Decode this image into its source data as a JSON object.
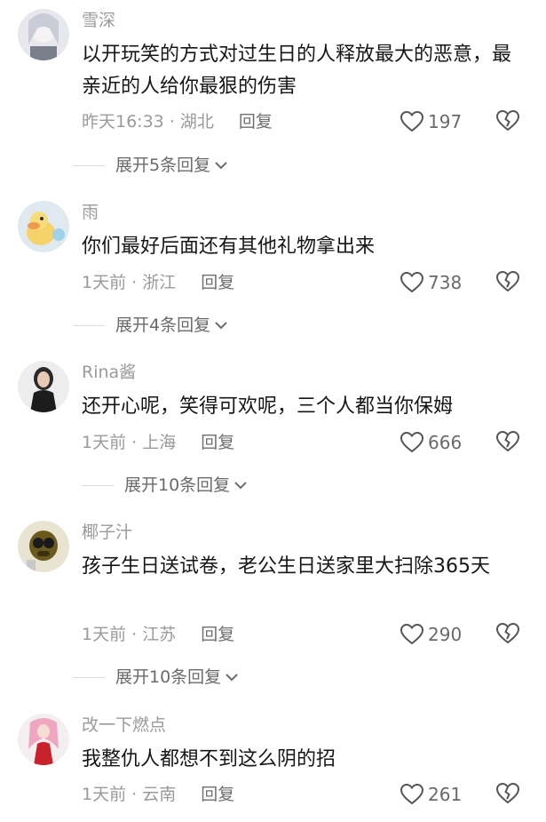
{
  "comments": [
    {
      "user": "雪深",
      "text": "以开玩笑的方式对过生日的人释放最大的恶意，最亲近的人给你最狠的伤害",
      "meta": "昨天16:33 · 湖北",
      "reply": "回复",
      "likes": "197",
      "expand": "展开5条回复"
    },
    {
      "user": "雨",
      "text": "你们最好后面还有其他礼物拿出来",
      "meta": "1天前 · 浙江",
      "reply": "回复",
      "likes": "738",
      "expand": "展开4条回复"
    },
    {
      "user": "Rina酱",
      "text": "还开心呢，笑得可欢呢，三个人都当你保姆",
      "meta": "1天前 · 上海",
      "reply": "回复",
      "likes": "666",
      "expand": "展开10条回复"
    },
    {
      "user": "椰子汁",
      "text": "孩子生日送试卷，老公生日送家里大扫除365天",
      "meta": "1天前 · 江苏",
      "reply": "回复",
      "likes": "290",
      "expand": "展开10条回复"
    },
    {
      "user": "改一下燃点",
      "text": "我整仇人都想不到这么阴的招",
      "meta": "1天前 · 云南",
      "reply": "回复",
      "likes": "261"
    }
  ],
  "icons": {
    "like": "heart-outline-icon",
    "dislike": "broken-heart-icon",
    "expand": "chevron-down-icon"
  },
  "colors": {
    "text": "#161616",
    "secondary": "#9a9a9a"
  }
}
